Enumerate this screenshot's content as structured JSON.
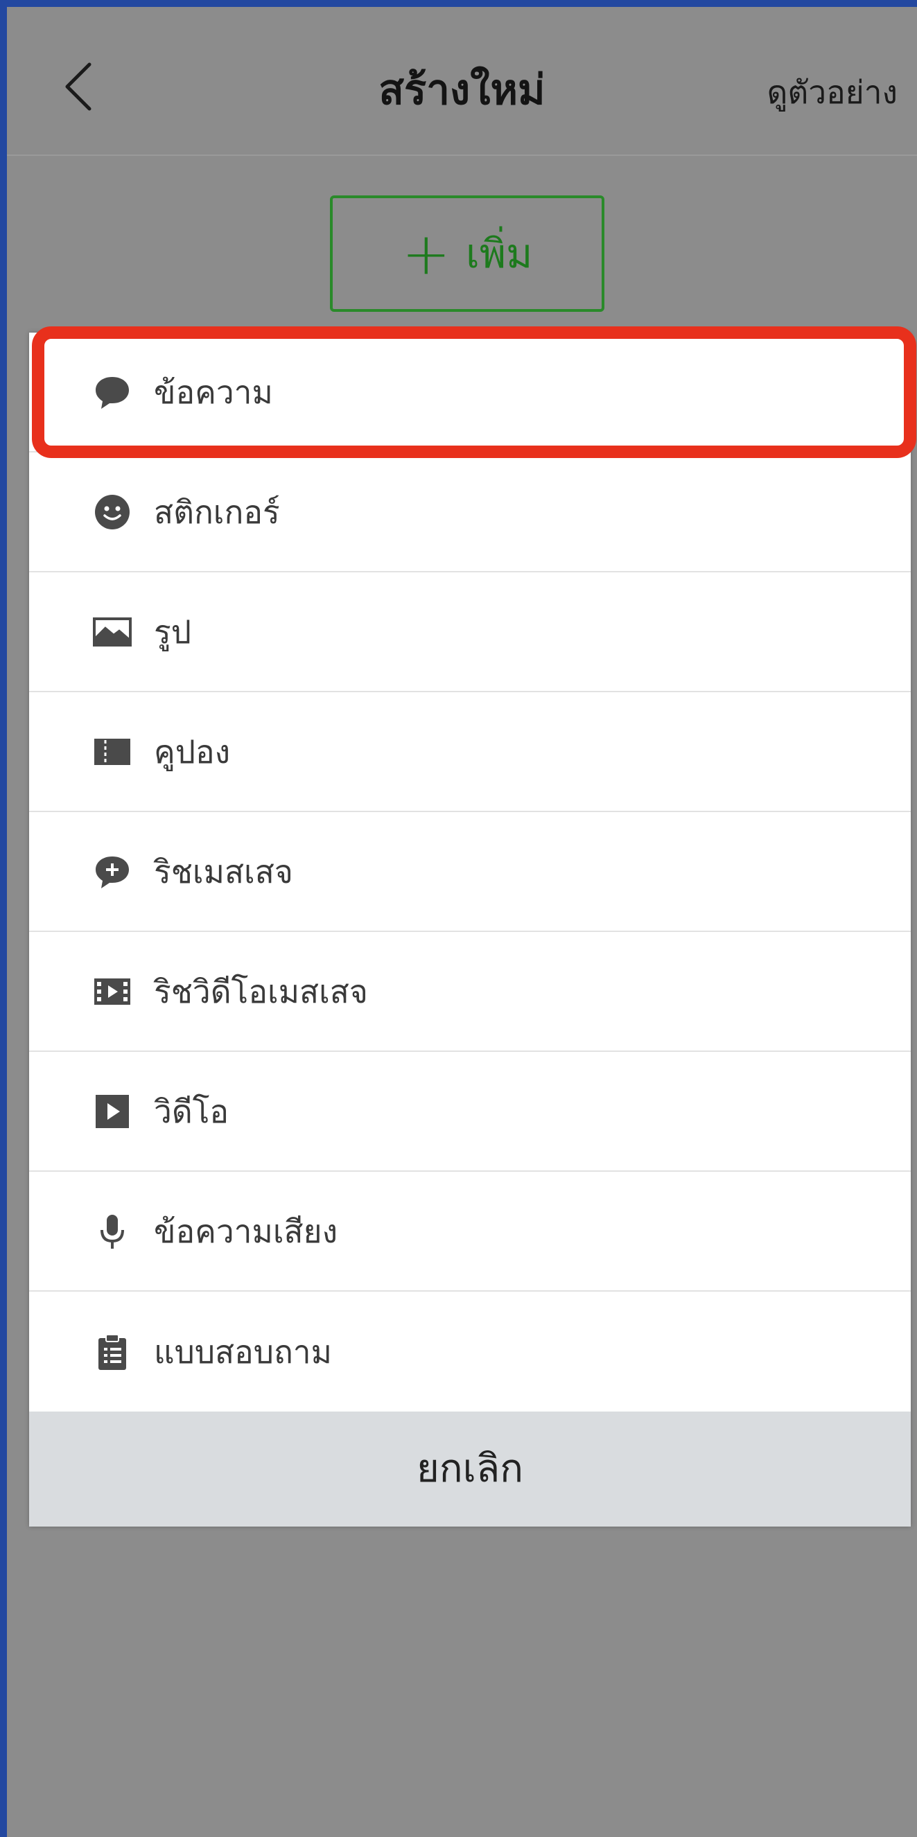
{
  "header": {
    "title": "สร้างใหม่",
    "preview_label": "ดูตัวอย่าง",
    "back_icon": "chevron-left-icon"
  },
  "add_button": {
    "plus": "+",
    "label": "เพิ่ม",
    "color": "#1d7a1d"
  },
  "menu": {
    "items": [
      {
        "label": "ข้อความ",
        "icon": "speech-bubble-icon"
      },
      {
        "label": "สติกเกอร์",
        "icon": "smiley-icon"
      },
      {
        "label": "รูป",
        "icon": "image-icon"
      },
      {
        "label": "คูปอง",
        "icon": "coupon-icon"
      },
      {
        "label": "ริชเมสเสจ",
        "icon": "rich-message-icon"
      },
      {
        "label": "ริชวิดีโอเมสเสจ",
        "icon": "film-icon"
      },
      {
        "label": "วิดีโอ",
        "icon": "play-icon"
      },
      {
        "label": "ข้อความเสียง",
        "icon": "microphone-icon"
      },
      {
        "label": "แบบสอบถาม",
        "icon": "clipboard-icon"
      }
    ],
    "cancel_label": "ยกเลิก"
  },
  "colors": {
    "overlay": "#8c8c8c",
    "highlight": "#e8301c",
    "frame": "#2348a0",
    "icon": "#4a4a4a"
  }
}
